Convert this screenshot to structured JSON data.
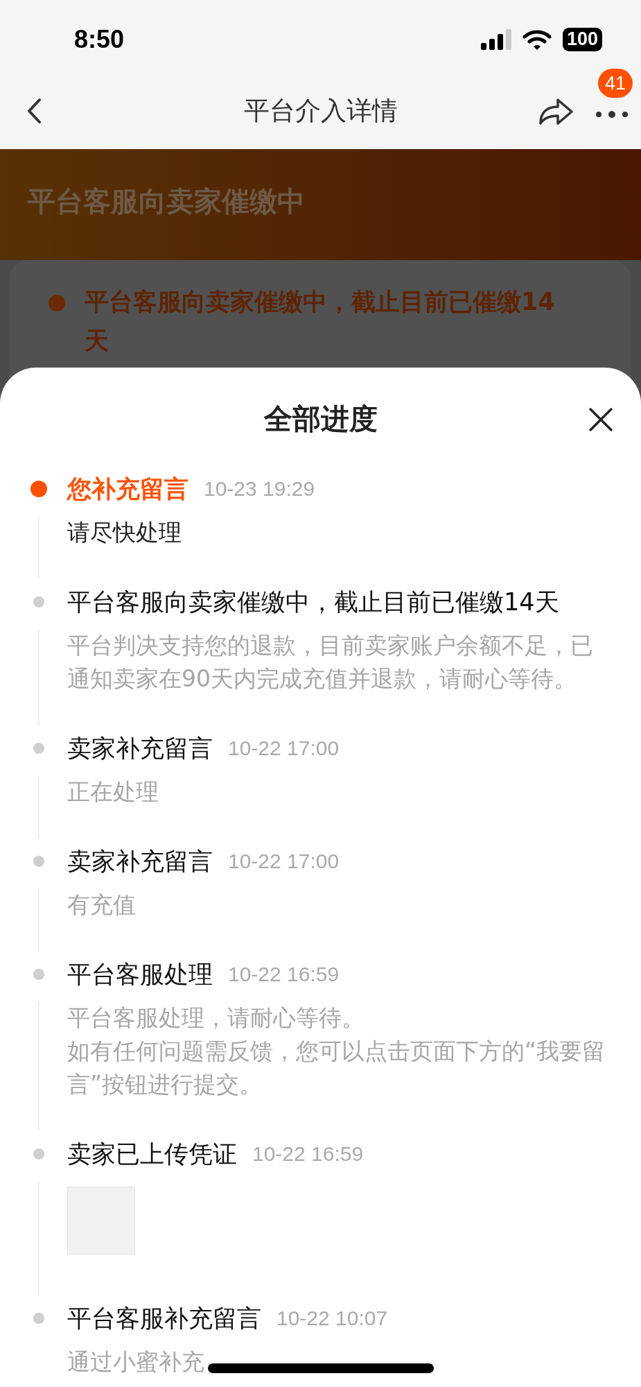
{
  "status_bar": {
    "time": "8:50",
    "battery": "100"
  },
  "nav": {
    "title": "平台介入详情",
    "badge": "41"
  },
  "banner": {
    "heading": "平台客服向卖家催缴中",
    "card_text": "平台客服向卖家催缴中，截止目前已催缴14天"
  },
  "sheet": {
    "title": "全部进度",
    "events": [
      {
        "kind": "text",
        "active": true,
        "title": "您补充留言",
        "time": "10-23 19:29",
        "desc": [
          "请尽快处理"
        ]
      },
      {
        "kind": "text",
        "active": false,
        "title": "平台客服向卖家催缴中，截止目前已催缴14天",
        "desc": [
          "平台判决支持您的退款，目前卖家账户余额不足，已通知卖家在90天内完成充值并退款，请耐心等待。"
        ]
      },
      {
        "kind": "text",
        "active": false,
        "title": "卖家补充留言",
        "time": "10-22 17:00",
        "desc": [
          "正在处理"
        ]
      },
      {
        "kind": "text",
        "active": false,
        "title": "卖家补充留言",
        "time": "10-22 17:00",
        "desc": [
          "有充值"
        ]
      },
      {
        "kind": "text",
        "active": false,
        "title": "平台客服处理",
        "time": "10-22 16:59",
        "desc": [
          "平台客服处理，请耐心等待。",
          "如有任何问题需反馈，您可以点击页面下方的“我要留言”按钮进行提交。"
        ]
      },
      {
        "kind": "image",
        "active": false,
        "title": "卖家已上传凭证",
        "time": "10-22 16:59"
      },
      {
        "kind": "text",
        "active": false,
        "title": "平台客服补充留言",
        "time": "10-22 10:07",
        "desc": [
          "通过小蜜补充"
        ]
      }
    ]
  }
}
